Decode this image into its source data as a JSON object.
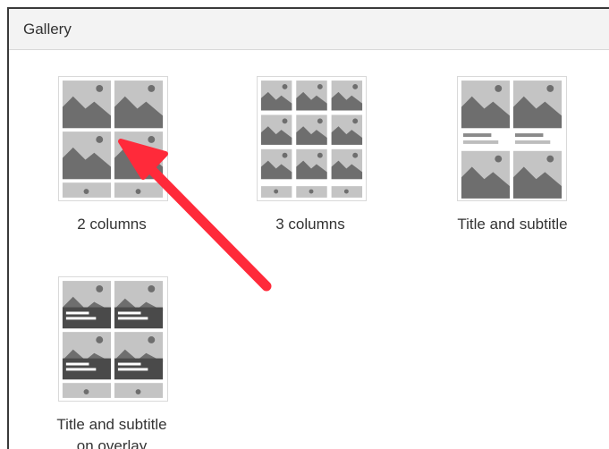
{
  "panel": {
    "title": "Gallery"
  },
  "layouts": [
    {
      "id": "two-columns",
      "label": "2 columns"
    },
    {
      "id": "three-columns",
      "label": "3 columns"
    },
    {
      "id": "title-subtitle",
      "label": "Title and subtitle"
    },
    {
      "id": "title-subtitle-overlay",
      "label_line1": "Title and subtitle",
      "label_line2": "on overlay"
    }
  ],
  "colors": {
    "placeholder_bg": "#c4c4c4",
    "mountain": "#6e6e6e",
    "overlay_bar": "#4a4a4a",
    "annotation_arrow": "#ff2a3a"
  }
}
